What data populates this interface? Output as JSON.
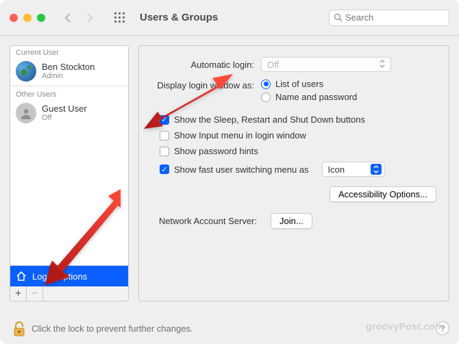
{
  "window": {
    "title": "Users & Groups"
  },
  "search": {
    "placeholder": "Search"
  },
  "sidebar": {
    "current_header": "Current User",
    "other_header": "Other Users",
    "current": {
      "name": "Ben Stockton",
      "role": "Admin"
    },
    "others": [
      {
        "name": "Guest User",
        "role": "Off"
      }
    ],
    "login_options": "Login Options",
    "add": "+",
    "remove": "−"
  },
  "settings": {
    "automatic_login_label": "Automatic login:",
    "automatic_login_value": "Off",
    "display_label": "Display login window as:",
    "radio_list": "List of users",
    "radio_namepw": "Name and password",
    "cb_sleep": "Show the Sleep, Restart and Shut Down buttons",
    "cb_input": "Show Input menu in login window",
    "cb_hints": "Show password hints",
    "cb_fast": "Show fast user switching menu as",
    "fast_value": "Icon",
    "accessibility": "Accessibility Options...",
    "network_label": "Network Account Server:",
    "join": "Join..."
  },
  "footer": {
    "lock_text": "Click the lock to prevent further changes.",
    "help": "?"
  },
  "watermark": "groovyPost.com"
}
